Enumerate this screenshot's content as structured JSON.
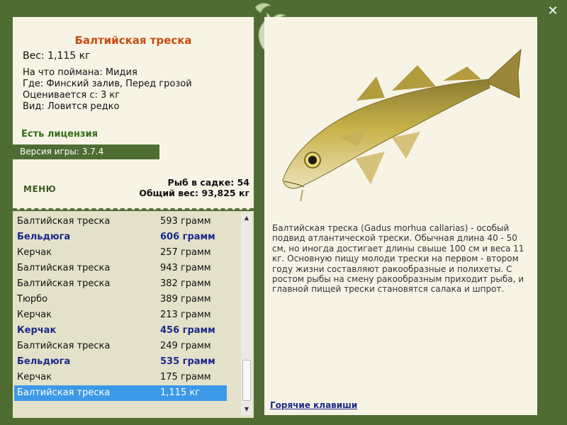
{
  "fish": {
    "title": "Балтийская треска",
    "weight": "Вес: 1,115 кг",
    "bait": "На что поймана: Мидия",
    "where": "Где: Финский залив, Перед грозой",
    "rated": "Оценивается с: 3 кг",
    "species": "Вид: Ловится редко"
  },
  "license": "Есть лицензия",
  "version": "Версия игры: 3.7.4",
  "menu_label": "МЕНЮ",
  "keepnet": {
    "count": "Рыб в садке: 54",
    "total_weight": "Общий вес: 93,825 кг"
  },
  "catch_list": [
    {
      "name": "Балтийская треска",
      "weight": "593 грамм",
      "bold": false,
      "selected": false
    },
    {
      "name": "Бельдюга",
      "weight": "606 грамм",
      "bold": true,
      "selected": false
    },
    {
      "name": "Керчак",
      "weight": "257 грамм",
      "bold": false,
      "selected": false
    },
    {
      "name": "Балтийская треска",
      "weight": "943 грамм",
      "bold": false,
      "selected": false
    },
    {
      "name": "Балтийская треска",
      "weight": "382 грамм",
      "bold": false,
      "selected": false
    },
    {
      "name": "Тюрбо",
      "weight": "389 грамм",
      "bold": false,
      "selected": false
    },
    {
      "name": "Керчак",
      "weight": "213 грамм",
      "bold": false,
      "selected": false
    },
    {
      "name": "Керчак",
      "weight": "456 грамм",
      "bold": true,
      "selected": false
    },
    {
      "name": "Балтийская треска",
      "weight": "249 грамм",
      "bold": false,
      "selected": false
    },
    {
      "name": "Бельдюга",
      "weight": "535 грамм",
      "bold": true,
      "selected": false
    },
    {
      "name": "Керчак",
      "weight": "175 грамм",
      "bold": false,
      "selected": false
    },
    {
      "name": "Балтийская треска",
      "weight": "1,115 кг",
      "bold": false,
      "selected": true
    }
  ],
  "description": "Балтийская треска (Gadus morhua callarias) - особый подвид атлантической трески. Обычная длина 40 - 50 см, но иногда достигает длины свыше 100 см и веса 11 кг. Основную пищу молоди трески на первом - втором году жизни составляют ракообразные и полихеты. С ростом рыбы на смену ракообразным приходит рыба, и главной пищей трески становятся салака и шпрот.",
  "hotkeys_link": "Горячие клавиши",
  "close_glyph": "✕",
  "icons": {
    "close": "close-icon",
    "scroll_up": "scroll-up-icon",
    "scroll_down": "scroll-down-icon"
  },
  "colors": {
    "frame": "#4f6d33",
    "title": "#c84b0c",
    "license": "#2e6e1a",
    "highlight_text": "#1c2a8a",
    "selection": "#3c99e8"
  }
}
